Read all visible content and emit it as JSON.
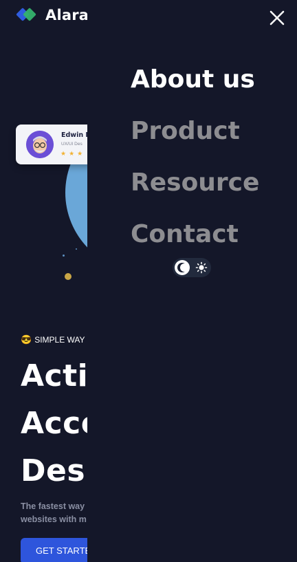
{
  "brand": {
    "name": "Alara"
  },
  "card": {
    "name": "Edwin M",
    "role": "UX/UI Des",
    "rating_stars": "★★★"
  },
  "hero": {
    "tagline_emoji": "😎",
    "tagline": "SIMPLE WAY",
    "headline": [
      "Actio",
      "Acce",
      "Desi"
    ],
    "desc": [
      "The fastest way",
      "websites with m"
    ],
    "cta": "GET STARTE"
  },
  "menu": {
    "items": [
      {
        "label": "About us",
        "active": true
      },
      {
        "label": "Product",
        "active": false
      },
      {
        "label": "Resource",
        "active": false
      },
      {
        "label": "Contact",
        "active": false
      }
    ]
  },
  "colors": {
    "background": "#141729",
    "accent": "#2e55dc",
    "menu_active": "#ffffff",
    "menu_inactive": "#8d8d91"
  },
  "icons": {
    "close": "close-icon",
    "moon": "moon-icon",
    "sun": "sun-icon"
  }
}
